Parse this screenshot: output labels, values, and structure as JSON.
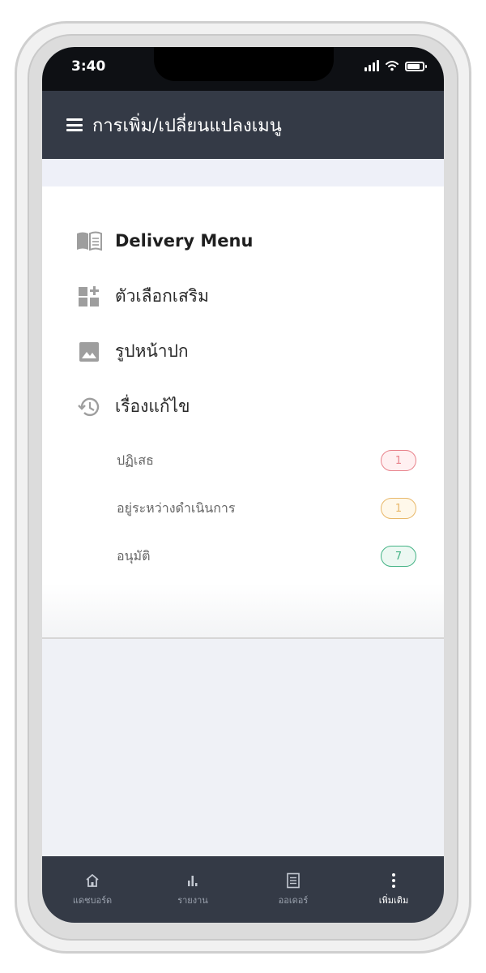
{
  "status_bar": {
    "time": "3:40"
  },
  "header": {
    "title": "การเพิ่ม/เปลี่ยนแปลงเมนู"
  },
  "menu": [
    {
      "label": "Delivery Menu",
      "icon": "menu-book-icon"
    },
    {
      "label": "ตัวเลือกเสริม",
      "icon": "add-options-icon"
    },
    {
      "label": "รูปหน้าปก",
      "icon": "image-icon"
    },
    {
      "label": "เรื่องแก้ไข",
      "icon": "history-icon"
    }
  ],
  "revisions": [
    {
      "label": "ปฏิเสธ",
      "count": "1",
      "badge_color": "#e8838c",
      "badge_bg": "#fff0f1"
    },
    {
      "label": "อยู่ระหว่างดำเนินการ",
      "count": "1",
      "badge_color": "#e8b86a",
      "badge_bg": "#fff8ea"
    },
    {
      "label": "อนุมัติ",
      "count": "7",
      "badge_color": "#45b386",
      "badge_bg": "#ecf8f2"
    }
  ],
  "bottom_nav": [
    {
      "label": "แดชบอร์ด",
      "icon": "home-icon"
    },
    {
      "label": "รายงาน",
      "icon": "bar-chart-icon"
    },
    {
      "label": "ออเดอร์",
      "icon": "order-list-icon"
    },
    {
      "label": "เพิ่มเติม",
      "icon": "more-vertical-icon"
    }
  ],
  "colors": {
    "header_bg": "#343a46",
    "screen_bg": "#eff1f6",
    "icon_gray": "#9e9e9e"
  }
}
